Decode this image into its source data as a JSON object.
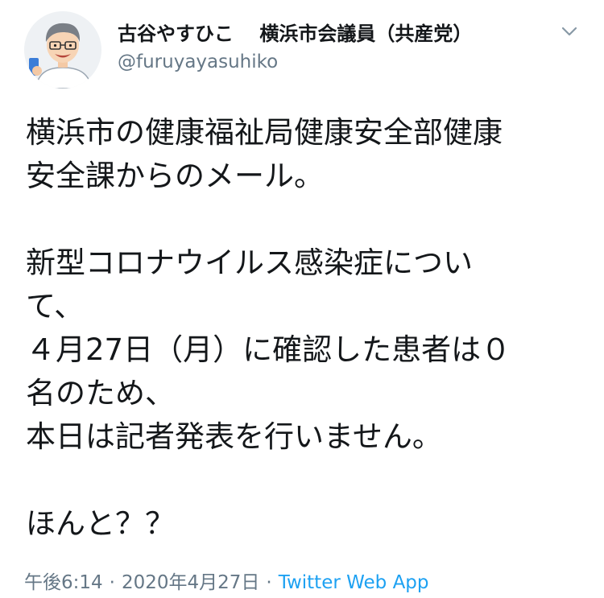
{
  "author": {
    "display_name": "古谷やすひこ　 横浜市会議員（共産党）",
    "handle": "@furuyayasuhiko"
  },
  "icons": {
    "avatar": "cartoon-man-portrait",
    "menu": "chevron-down-icon"
  },
  "body": {
    "lines": [
      "横浜市の健康福祉局健康安全部健康",
      "安全課からのメール。",
      "",
      "新型コロナウイルス感染症につい",
      "て、",
      "４月27日（月）に確認した患者は０",
      "名のため、",
      "本日は記者発表を行いません。",
      "",
      "ほんと？？"
    ]
  },
  "meta": {
    "time": "午後6:14",
    "separator": "·",
    "date": "2020年4月27日",
    "source": "Twitter Web App"
  },
  "colors": {
    "text": "#14171a",
    "secondary": "#657786",
    "link": "#1da1f2"
  }
}
